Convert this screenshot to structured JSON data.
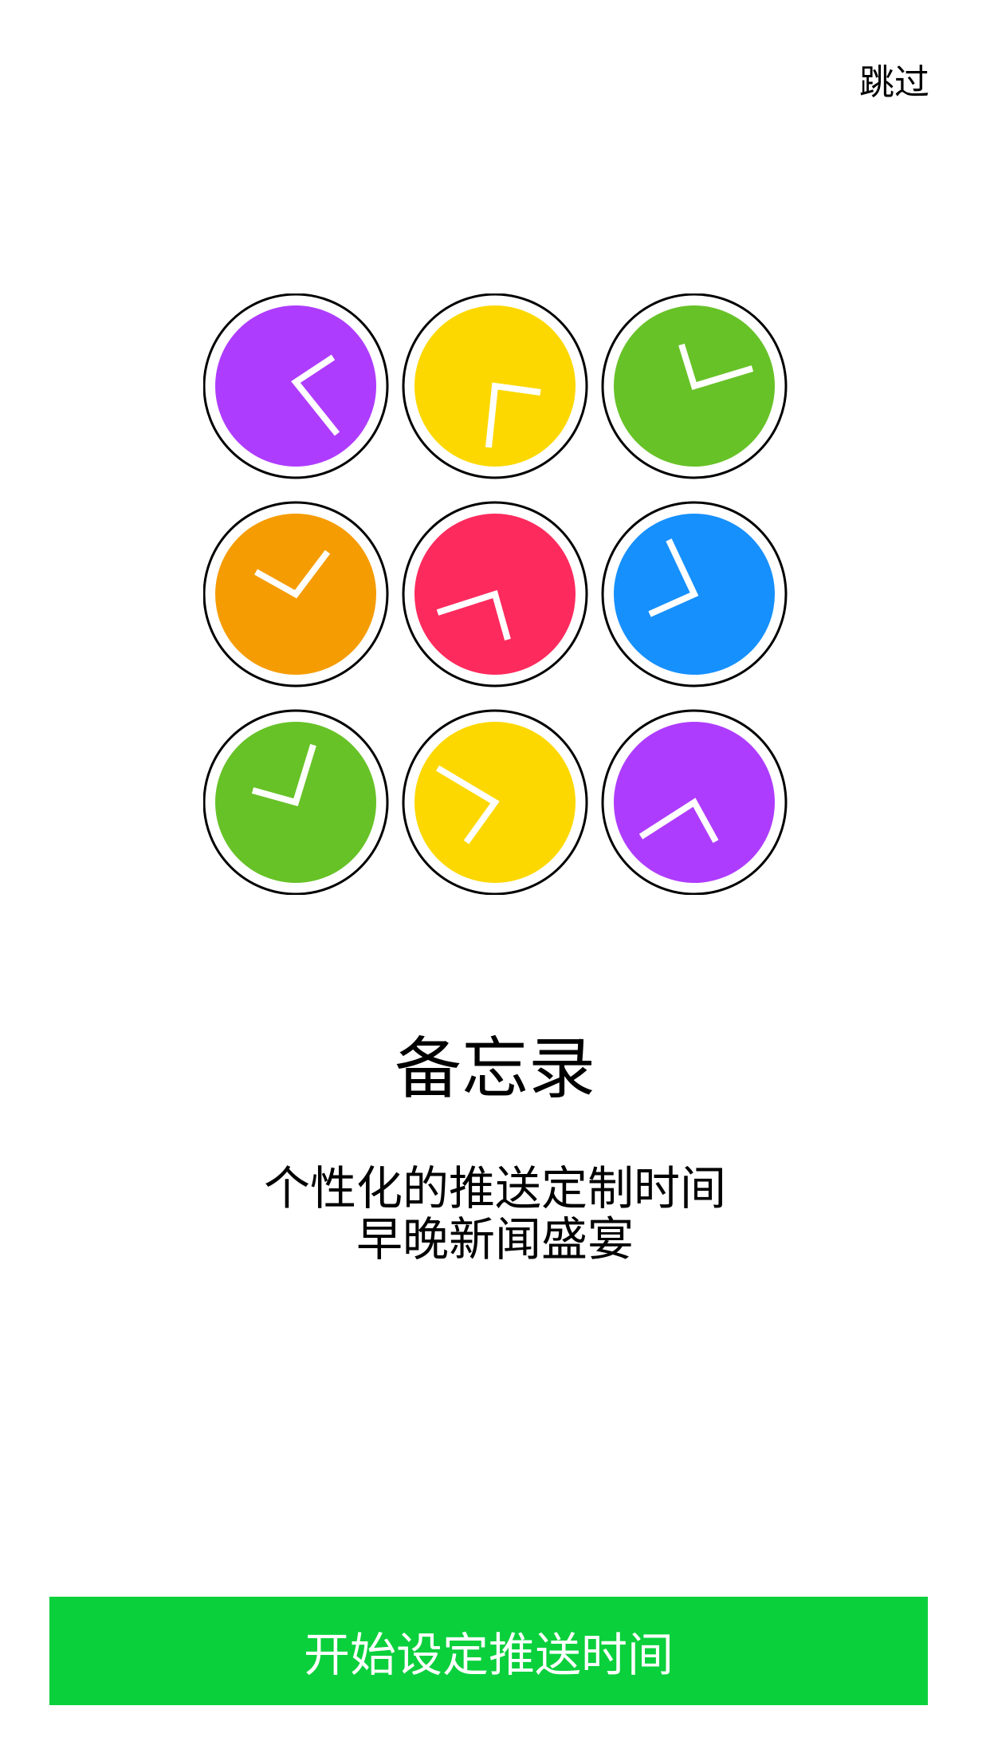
{
  "header": {
    "skip_label": "跳过"
  },
  "clocks": [
    {
      "color": "#ae3cfe",
      "icon": "clock-icon"
    },
    {
      "color": "#fcd800",
      "icon": "clock-icon"
    },
    {
      "color": "#67c227",
      "icon": "clock-icon"
    },
    {
      "color": "#f59c03",
      "icon": "clock-icon"
    },
    {
      "color": "#fd2a5d",
      "icon": "clock-icon"
    },
    {
      "color": "#1690fd",
      "icon": "clock-icon"
    },
    {
      "color": "#67c227",
      "icon": "clock-icon"
    },
    {
      "color": "#fcd800",
      "icon": "clock-icon"
    },
    {
      "color": "#ae3cfe",
      "icon": "clock-icon"
    }
  ],
  "main": {
    "title": "备忘录",
    "subtitle_line1": "个性化的推送定制时间",
    "subtitle_line2": "早晚新闻盛宴"
  },
  "footer": {
    "start_button_label": "开始设定推送时间",
    "start_button_color": "#0ad03c"
  }
}
